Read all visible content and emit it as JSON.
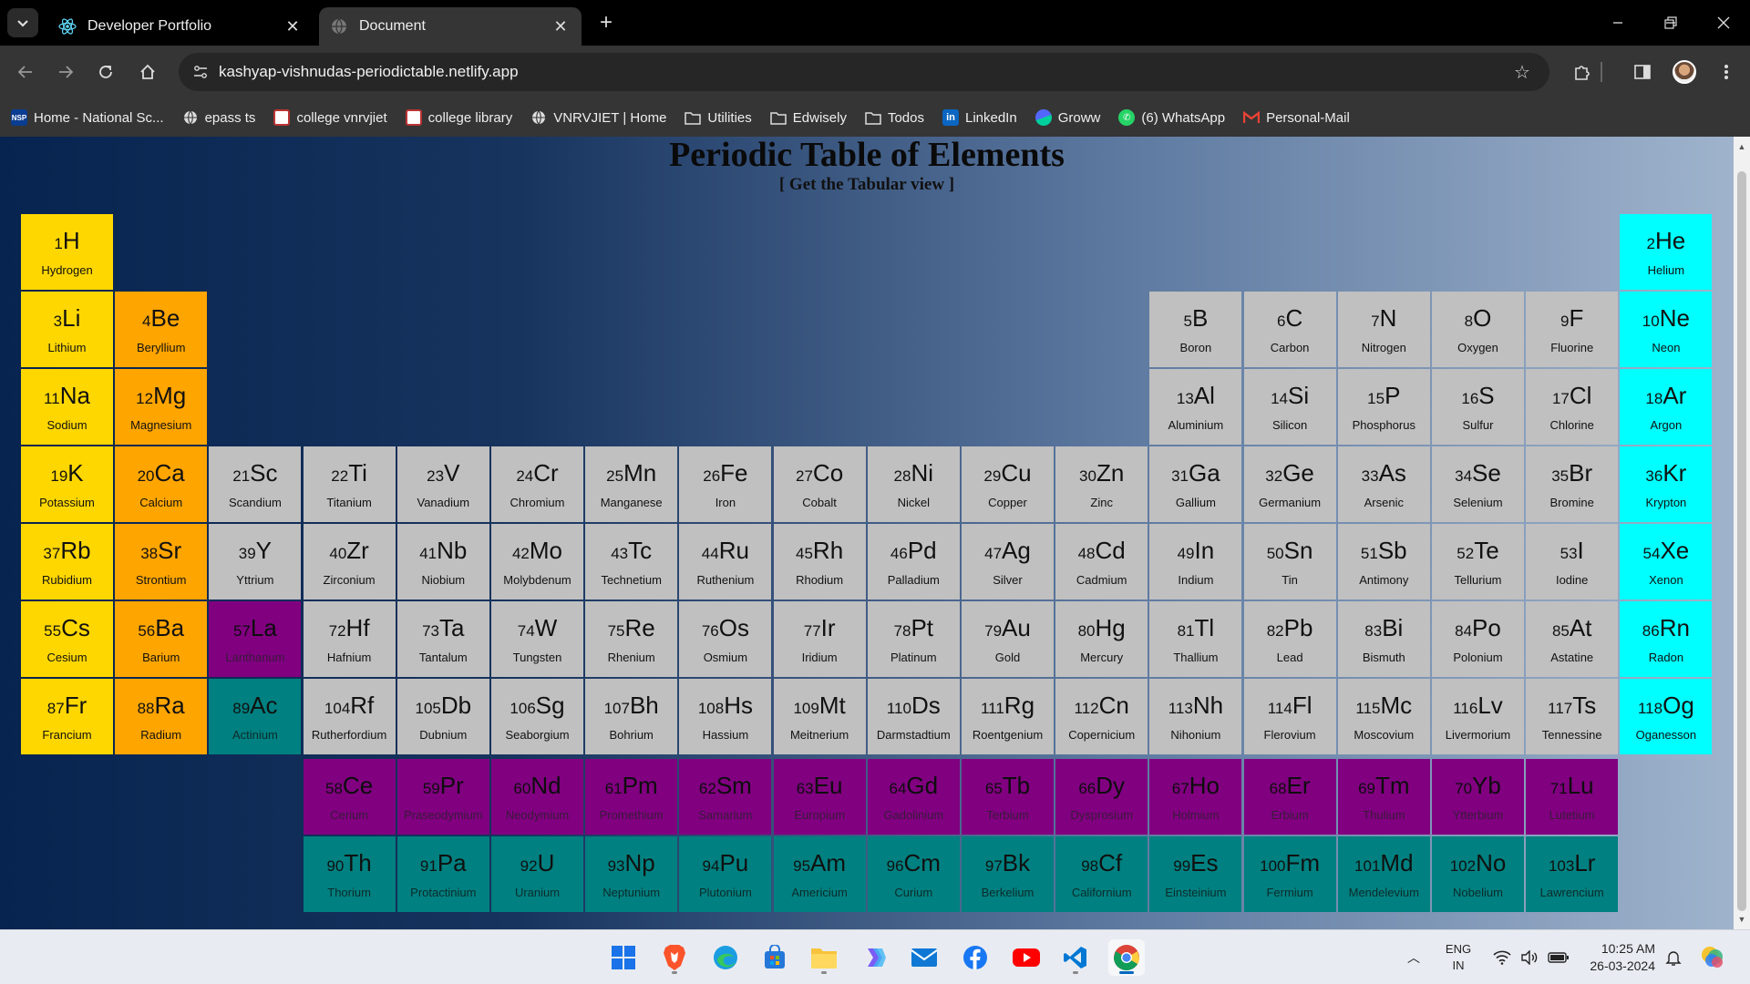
{
  "browser": {
    "tabs": [
      {
        "title": "Developer Portfolio",
        "icon": "react-icon"
      },
      {
        "title": "Document",
        "icon": "globe-icon"
      }
    ],
    "url": "kashyap-vishnudas-periodictable.netlify.app",
    "bookmarks": [
      {
        "label": "Home - National Sc...",
        "icon": "nsp-icon"
      },
      {
        "label": "epass ts",
        "icon": "globe-icon"
      },
      {
        "label": "college vnrvjiet",
        "icon": "college-logo-icon"
      },
      {
        "label": "college library",
        "icon": "college-logo-icon"
      },
      {
        "label": "VNRVJIET | Home",
        "icon": "globe-icon"
      },
      {
        "label": "Utilities",
        "icon": "folder-icon"
      },
      {
        "label": "Edwisely",
        "icon": "folder-icon"
      },
      {
        "label": "Todos",
        "icon": "folder-icon"
      },
      {
        "label": "LinkedIn",
        "icon": "linkedin-icon"
      },
      {
        "label": "Groww",
        "icon": "groww-icon"
      },
      {
        "label": "(6) WhatsApp",
        "icon": "whatsapp-icon"
      },
      {
        "label": "Personal-Mail",
        "icon": "gmail-icon"
      }
    ]
  },
  "page": {
    "title": "Periodic Table of Elements",
    "tabular_link": "[ Get the Tabular view ]",
    "colors": {
      "alkali": "#ffd700",
      "alkaline": "#ffa500",
      "transition": "#c0c0c0",
      "noble": "#00ffff",
      "lanthanide": "#800080",
      "actinide": "#008080"
    },
    "elements": [
      {
        "n": 1,
        "s": "H",
        "name": "Hydrogen",
        "cat": "alkali",
        "col": 1,
        "row": 1
      },
      {
        "n": 2,
        "s": "He",
        "name": "Helium",
        "cat": "noble",
        "col": 18,
        "row": 1
      },
      {
        "n": 3,
        "s": "Li",
        "name": "Lithium",
        "cat": "alkali",
        "col": 1,
        "row": 2
      },
      {
        "n": 4,
        "s": "Be",
        "name": "Beryllium",
        "cat": "alkaline",
        "col": 2,
        "row": 2
      },
      {
        "n": 5,
        "s": "B",
        "name": "Boron",
        "cat": "transition",
        "col": 13,
        "row": 2
      },
      {
        "n": 6,
        "s": "C",
        "name": "Carbon",
        "cat": "transition",
        "col": 14,
        "row": 2
      },
      {
        "n": 7,
        "s": "N",
        "name": "Nitrogen",
        "cat": "transition",
        "col": 15,
        "row": 2
      },
      {
        "n": 8,
        "s": "O",
        "name": "Oxygen",
        "cat": "transition",
        "col": 16,
        "row": 2
      },
      {
        "n": 9,
        "s": "F",
        "name": "Fluorine",
        "cat": "transition",
        "col": 17,
        "row": 2
      },
      {
        "n": 10,
        "s": "Ne",
        "name": "Neon",
        "cat": "noble",
        "col": 18,
        "row": 2
      },
      {
        "n": 11,
        "s": "Na",
        "name": "Sodium",
        "cat": "alkali",
        "col": 1,
        "row": 3
      },
      {
        "n": 12,
        "s": "Mg",
        "name": "Magnesium",
        "cat": "alkaline",
        "col": 2,
        "row": 3
      },
      {
        "n": 13,
        "s": "Al",
        "name": "Aluminium",
        "cat": "transition",
        "col": 13,
        "row": 3
      },
      {
        "n": 14,
        "s": "Si",
        "name": "Silicon",
        "cat": "transition",
        "col": 14,
        "row": 3
      },
      {
        "n": 15,
        "s": "P",
        "name": "Phosphorus",
        "cat": "transition",
        "col": 15,
        "row": 3
      },
      {
        "n": 16,
        "s": "S",
        "name": "Sulfur",
        "cat": "transition",
        "col": 16,
        "row": 3
      },
      {
        "n": 17,
        "s": "Cl",
        "name": "Chlorine",
        "cat": "transition",
        "col": 17,
        "row": 3
      },
      {
        "n": 18,
        "s": "Ar",
        "name": "Argon",
        "cat": "noble",
        "col": 18,
        "row": 3
      },
      {
        "n": 19,
        "s": "K",
        "name": "Potassium",
        "cat": "alkali",
        "col": 1,
        "row": 4
      },
      {
        "n": 20,
        "s": "Ca",
        "name": "Calcium",
        "cat": "alkaline",
        "col": 2,
        "row": 4
      },
      {
        "n": 21,
        "s": "Sc",
        "name": "Scandium",
        "cat": "transition",
        "col": 3,
        "row": 4
      },
      {
        "n": 22,
        "s": "Ti",
        "name": "Titanium",
        "cat": "transition",
        "col": 4,
        "row": 4
      },
      {
        "n": 23,
        "s": "V",
        "name": "Vanadium",
        "cat": "transition",
        "col": 5,
        "row": 4
      },
      {
        "n": 24,
        "s": "Cr",
        "name": "Chromium",
        "cat": "transition",
        "col": 6,
        "row": 4
      },
      {
        "n": 25,
        "s": "Mn",
        "name": "Manganese",
        "cat": "transition",
        "col": 7,
        "row": 4
      },
      {
        "n": 26,
        "s": "Fe",
        "name": "Iron",
        "cat": "transition",
        "col": 8,
        "row": 4
      },
      {
        "n": 27,
        "s": "Co",
        "name": "Cobalt",
        "cat": "transition",
        "col": 9,
        "row": 4
      },
      {
        "n": 28,
        "s": "Ni",
        "name": "Nickel",
        "cat": "transition",
        "col": 10,
        "row": 4
      },
      {
        "n": 29,
        "s": "Cu",
        "name": "Copper",
        "cat": "transition",
        "col": 11,
        "row": 4
      },
      {
        "n": 30,
        "s": "Zn",
        "name": "Zinc",
        "cat": "transition",
        "col": 12,
        "row": 4
      },
      {
        "n": 31,
        "s": "Ga",
        "name": "Gallium",
        "cat": "transition",
        "col": 13,
        "row": 4
      },
      {
        "n": 32,
        "s": "Ge",
        "name": "Germanium",
        "cat": "transition",
        "col": 14,
        "row": 4
      },
      {
        "n": 33,
        "s": "As",
        "name": "Arsenic",
        "cat": "transition",
        "col": 15,
        "row": 4
      },
      {
        "n": 34,
        "s": "Se",
        "name": "Selenium",
        "cat": "transition",
        "col": 16,
        "row": 4
      },
      {
        "n": 35,
        "s": "Br",
        "name": "Bromine",
        "cat": "transition",
        "col": 17,
        "row": 4
      },
      {
        "n": 36,
        "s": "Kr",
        "name": "Krypton",
        "cat": "noble",
        "col": 18,
        "row": 4
      },
      {
        "n": 37,
        "s": "Rb",
        "name": "Rubidium",
        "cat": "alkali",
        "col": 1,
        "row": 5
      },
      {
        "n": 38,
        "s": "Sr",
        "name": "Strontium",
        "cat": "alkaline",
        "col": 2,
        "row": 5
      },
      {
        "n": 39,
        "s": "Y",
        "name": "Yttrium",
        "cat": "transition",
        "col": 3,
        "row": 5
      },
      {
        "n": 40,
        "s": "Zr",
        "name": "Zirconium",
        "cat": "transition",
        "col": 4,
        "row": 5
      },
      {
        "n": 41,
        "s": "Nb",
        "name": "Niobium",
        "cat": "transition",
        "col": 5,
        "row": 5
      },
      {
        "n": 42,
        "s": "Mo",
        "name": "Molybdenum",
        "cat": "transition",
        "col": 6,
        "row": 5
      },
      {
        "n": 43,
        "s": "Tc",
        "name": "Technetium",
        "cat": "transition",
        "col": 7,
        "row": 5
      },
      {
        "n": 44,
        "s": "Ru",
        "name": "Ruthenium",
        "cat": "transition",
        "col": 8,
        "row": 5
      },
      {
        "n": 45,
        "s": "Rh",
        "name": "Rhodium",
        "cat": "transition",
        "col": 9,
        "row": 5
      },
      {
        "n": 46,
        "s": "Pd",
        "name": "Palladium",
        "cat": "transition",
        "col": 10,
        "row": 5
      },
      {
        "n": 47,
        "s": "Ag",
        "name": "Silver",
        "cat": "transition",
        "col": 11,
        "row": 5
      },
      {
        "n": 48,
        "s": "Cd",
        "name": "Cadmium",
        "cat": "transition",
        "col": 12,
        "row": 5
      },
      {
        "n": 49,
        "s": "In",
        "name": "Indium",
        "cat": "transition",
        "col": 13,
        "row": 5
      },
      {
        "n": 50,
        "s": "Sn",
        "name": "Tin",
        "cat": "transition",
        "col": 14,
        "row": 5
      },
      {
        "n": 51,
        "s": "Sb",
        "name": "Antimony",
        "cat": "transition",
        "col": 15,
        "row": 5
      },
      {
        "n": 52,
        "s": "Te",
        "name": "Tellurium",
        "cat": "transition",
        "col": 16,
        "row": 5
      },
      {
        "n": 53,
        "s": "I",
        "name": "Iodine",
        "cat": "transition",
        "col": 17,
        "row": 5
      },
      {
        "n": 54,
        "s": "Xe",
        "name": "Xenon",
        "cat": "noble",
        "col": 18,
        "row": 5
      },
      {
        "n": 55,
        "s": "Cs",
        "name": "Cesium",
        "cat": "alkali",
        "col": 1,
        "row": 6
      },
      {
        "n": 56,
        "s": "Ba",
        "name": "Barium",
        "cat": "alkaline",
        "col": 2,
        "row": 6
      },
      {
        "n": 57,
        "s": "La",
        "name": "Lanthanum",
        "cat": "lanthanide",
        "col": 3,
        "row": 6
      },
      {
        "n": 72,
        "s": "Hf",
        "name": "Hafnium",
        "cat": "transition",
        "col": 4,
        "row": 6
      },
      {
        "n": 73,
        "s": "Ta",
        "name": "Tantalum",
        "cat": "transition",
        "col": 5,
        "row": 6
      },
      {
        "n": 74,
        "s": "W",
        "name": "Tungsten",
        "cat": "transition",
        "col": 6,
        "row": 6
      },
      {
        "n": 75,
        "s": "Re",
        "name": "Rhenium",
        "cat": "transition",
        "col": 7,
        "row": 6
      },
      {
        "n": 76,
        "s": "Os",
        "name": "Osmium",
        "cat": "transition",
        "col": 8,
        "row": 6
      },
      {
        "n": 77,
        "s": "Ir",
        "name": "Iridium",
        "cat": "transition",
        "col": 9,
        "row": 6
      },
      {
        "n": 78,
        "s": "Pt",
        "name": "Platinum",
        "cat": "transition",
        "col": 10,
        "row": 6
      },
      {
        "n": 79,
        "s": "Au",
        "name": "Gold",
        "cat": "transition",
        "col": 11,
        "row": 6
      },
      {
        "n": 80,
        "s": "Hg",
        "name": "Mercury",
        "cat": "transition",
        "col": 12,
        "row": 6
      },
      {
        "n": 81,
        "s": "Tl",
        "name": "Thallium",
        "cat": "transition",
        "col": 13,
        "row": 6
      },
      {
        "n": 82,
        "s": "Pb",
        "name": "Lead",
        "cat": "transition",
        "col": 14,
        "row": 6
      },
      {
        "n": 83,
        "s": "Bi",
        "name": "Bismuth",
        "cat": "transition",
        "col": 15,
        "row": 6
      },
      {
        "n": 84,
        "s": "Po",
        "name": "Polonium",
        "cat": "transition",
        "col": 16,
        "row": 6
      },
      {
        "n": 85,
        "s": "At",
        "name": "Astatine",
        "cat": "transition",
        "col": 17,
        "row": 6
      },
      {
        "n": 86,
        "s": "Rn",
        "name": "Radon",
        "cat": "noble",
        "col": 18,
        "row": 6
      },
      {
        "n": 87,
        "s": "Fr",
        "name": "Francium",
        "cat": "alkali",
        "col": 1,
        "row": 7
      },
      {
        "n": 88,
        "s": "Ra",
        "name": "Radium",
        "cat": "alkaline",
        "col": 2,
        "row": 7
      },
      {
        "n": 89,
        "s": "Ac",
        "name": "Actinium",
        "cat": "actinide",
        "col": 3,
        "row": 7
      },
      {
        "n": 104,
        "s": "Rf",
        "name": "Rutherfordium",
        "cat": "transition",
        "col": 4,
        "row": 7
      },
      {
        "n": 105,
        "s": "Db",
        "name": "Dubnium",
        "cat": "transition",
        "col": 5,
        "row": 7
      },
      {
        "n": 106,
        "s": "Sg",
        "name": "Seaborgium",
        "cat": "transition",
        "col": 6,
        "row": 7
      },
      {
        "n": 107,
        "s": "Bh",
        "name": "Bohrium",
        "cat": "transition",
        "col": 7,
        "row": 7
      },
      {
        "n": 108,
        "s": "Hs",
        "name": "Hassium",
        "cat": "transition",
        "col": 8,
        "row": 7
      },
      {
        "n": 109,
        "s": "Mt",
        "name": "Meitnerium",
        "cat": "transition",
        "col": 9,
        "row": 7
      },
      {
        "n": 110,
        "s": "Ds",
        "name": "Darmstadtium",
        "cat": "transition",
        "col": 10,
        "row": 7
      },
      {
        "n": 111,
        "s": "Rg",
        "name": "Roentgenium",
        "cat": "transition",
        "col": 11,
        "row": 7
      },
      {
        "n": 112,
        "s": "Cn",
        "name": "Copernicium",
        "cat": "transition",
        "col": 12,
        "row": 7
      },
      {
        "n": 113,
        "s": "Nh",
        "name": "Nihonium",
        "cat": "transition",
        "col": 13,
        "row": 7
      },
      {
        "n": 114,
        "s": "Fl",
        "name": "Flerovium",
        "cat": "transition",
        "col": 14,
        "row": 7
      },
      {
        "n": 115,
        "s": "Mc",
        "name": "Moscovium",
        "cat": "transition",
        "col": 15,
        "row": 7
      },
      {
        "n": 116,
        "s": "Lv",
        "name": "Livermorium",
        "cat": "transition",
        "col": 16,
        "row": 7
      },
      {
        "n": 117,
        "s": "Ts",
        "name": "Tennessine",
        "cat": "transition",
        "col": 17,
        "row": 7
      },
      {
        "n": 118,
        "s": "Og",
        "name": "Oganesson",
        "cat": "noble",
        "col": 18,
        "row": 7
      },
      {
        "n": 58,
        "s": "Ce",
        "name": "Cerium",
        "cat": "lanthanide",
        "col": 4,
        "row": 8
      },
      {
        "n": 59,
        "s": "Pr",
        "name": "Praseodymium",
        "cat": "lanthanide",
        "col": 5,
        "row": 8
      },
      {
        "n": 60,
        "s": "Nd",
        "name": "Neodymium",
        "cat": "lanthanide",
        "col": 6,
        "row": 8
      },
      {
        "n": 61,
        "s": "Pm",
        "name": "Promethium",
        "cat": "lanthanide",
        "col": 7,
        "row": 8
      },
      {
        "n": 62,
        "s": "Sm",
        "name": "Samarium",
        "cat": "lanthanide",
        "col": 8,
        "row": 8
      },
      {
        "n": 63,
        "s": "Eu",
        "name": "Europium",
        "cat": "lanthanide",
        "col": 9,
        "row": 8
      },
      {
        "n": 64,
        "s": "Gd",
        "name": "Gadolinium",
        "cat": "lanthanide",
        "col": 10,
        "row": 8
      },
      {
        "n": 65,
        "s": "Tb",
        "name": "Terbium",
        "cat": "lanthanide",
        "col": 11,
        "row": 8
      },
      {
        "n": 66,
        "s": "Dy",
        "name": "Dysprosium",
        "cat": "lanthanide",
        "col": 12,
        "row": 8
      },
      {
        "n": 67,
        "s": "Ho",
        "name": "Holmium",
        "cat": "lanthanide",
        "col": 13,
        "row": 8
      },
      {
        "n": 68,
        "s": "Er",
        "name": "Erbium",
        "cat": "lanthanide",
        "col": 14,
        "row": 8
      },
      {
        "n": 69,
        "s": "Tm",
        "name": "Thulium",
        "cat": "lanthanide",
        "col": 15,
        "row": 8
      },
      {
        "n": 70,
        "s": "Yb",
        "name": "Ytterbium",
        "cat": "lanthanide",
        "col": 16,
        "row": 8
      },
      {
        "n": 71,
        "s": "Lu",
        "name": "Lutetium",
        "cat": "lanthanide",
        "col": 17,
        "row": 8
      },
      {
        "n": 90,
        "s": "Th",
        "name": "Thorium",
        "cat": "actinide",
        "col": 4,
        "row": 9
      },
      {
        "n": 91,
        "s": "Pa",
        "name": "Protactinium",
        "cat": "actinide",
        "col": 5,
        "row": 9
      },
      {
        "n": 92,
        "s": "U",
        "name": "Uranium",
        "cat": "actinide",
        "col": 6,
        "row": 9
      },
      {
        "n": 93,
        "s": "Np",
        "name": "Neptunium",
        "cat": "actinide",
        "col": 7,
        "row": 9
      },
      {
        "n": 94,
        "s": "Pu",
        "name": "Plutonium",
        "cat": "actinide",
        "col": 8,
        "row": 9
      },
      {
        "n": 95,
        "s": "Am",
        "name": "Americium",
        "cat": "actinide",
        "col": 9,
        "row": 9
      },
      {
        "n": 96,
        "s": "Cm",
        "name": "Curium",
        "cat": "actinide",
        "col": 10,
        "row": 9
      },
      {
        "n": 97,
        "s": "Bk",
        "name": "Berkelium",
        "cat": "actinide",
        "col": 11,
        "row": 9
      },
      {
        "n": 98,
        "s": "Cf",
        "name": "Californium",
        "cat": "actinide",
        "col": 12,
        "row": 9
      },
      {
        "n": 99,
        "s": "Es",
        "name": "Einsteinium",
        "cat": "actinide",
        "col": 13,
        "row": 9
      },
      {
        "n": 100,
        "s": "Fm",
        "name": "Fermium",
        "cat": "actinide",
        "col": 14,
        "row": 9
      },
      {
        "n": 101,
        "s": "Md",
        "name": "Mendelevium",
        "cat": "actinide",
        "col": 15,
        "row": 9
      },
      {
        "n": 102,
        "s": "No",
        "name": "Nobelium",
        "cat": "actinide",
        "col": 16,
        "row": 9
      },
      {
        "n": 103,
        "s": "Lr",
        "name": "Lawrencium",
        "cat": "actinide",
        "col": 17,
        "row": 9
      }
    ]
  },
  "taskbar": {
    "apps": [
      "windows-start-icon",
      "brave-icon",
      "edge-icon",
      "store-icon",
      "file-explorer-icon",
      "copilot-icon",
      "mail-icon",
      "facebook-icon",
      "youtube-icon",
      "vscode-icon",
      "chrome-icon"
    ],
    "language": "ENG",
    "region": "IN",
    "time": "10:25 AM",
    "date": "26-03-2024"
  }
}
